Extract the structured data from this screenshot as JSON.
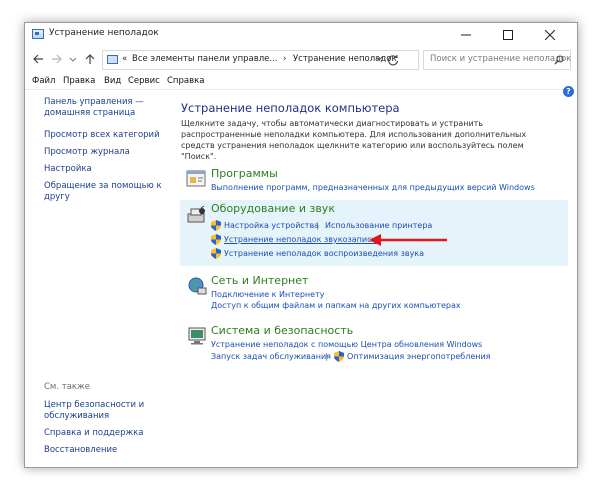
{
  "window": {
    "title": "Устранение неполадок"
  },
  "address_bar": {
    "overflow": "«",
    "crumb1": "Все элементы панели управле...",
    "sep": "›",
    "crumb2": "Устранение неполадок",
    "search_placeholder": "Поиск и устранение неполадок"
  },
  "menu": [
    "Файл",
    "Правка",
    "Вид",
    "Сервис",
    "Справка"
  ],
  "sidebar": {
    "links": [
      {
        "label": "Панель управления —"
      },
      {
        "label": "домашняя страница"
      },
      {
        "label": "Просмотр всех категорий"
      },
      {
        "label": "Просмотр журнала"
      },
      {
        "label": "Настройка"
      },
      {
        "label": "Обращение за помощью к"
      },
      {
        "label": "другу"
      }
    ],
    "see_also": "См. также",
    "see_also_links": [
      {
        "label": "Центр безопасности и"
      },
      {
        "label": "обслуживания"
      },
      {
        "label": "Справка и поддержка"
      },
      {
        "label": "Восстановление"
      }
    ]
  },
  "main": {
    "title": "Устранение неполадок компьютера",
    "description": "Щелкните задачу, чтобы автоматически диагностировать и устранить распространенные неполадки компьютера. Для использования дополнительных средств устранения неполадок щелкните категорию или воспользуйтесь полем \"Поиск\".",
    "categories": [
      {
        "title": "Программы",
        "links": [
          "Выполнение программ, предназначенных для предыдущих версий Windows"
        ]
      },
      {
        "title": "Оборудование и звук",
        "links": [
          "Настройка устройства",
          "Использование принтера",
          "Устранение неполадок звукозаписи",
          "Устранение неполадок воспроизведения звука"
        ]
      },
      {
        "title": "Сеть и Интернет",
        "links": [
          "Подключение к Интернету",
          "Доступ к общим файлам и папкам на других компьютерах"
        ]
      },
      {
        "title": "Система и безопасность",
        "links": [
          "Устранение неполадок с помощью Центра обновления Windows",
          "Запуск задач обслуживания",
          "Оптимизация энергопотребления"
        ]
      }
    ],
    "link_separator": "|"
  },
  "help_label": "?",
  "colors": {
    "link": "#1b4fb5",
    "category": "#2e7d1f",
    "title": "#1e3287",
    "arrow": "#e0161e",
    "highlight": "#e5f3fb"
  }
}
